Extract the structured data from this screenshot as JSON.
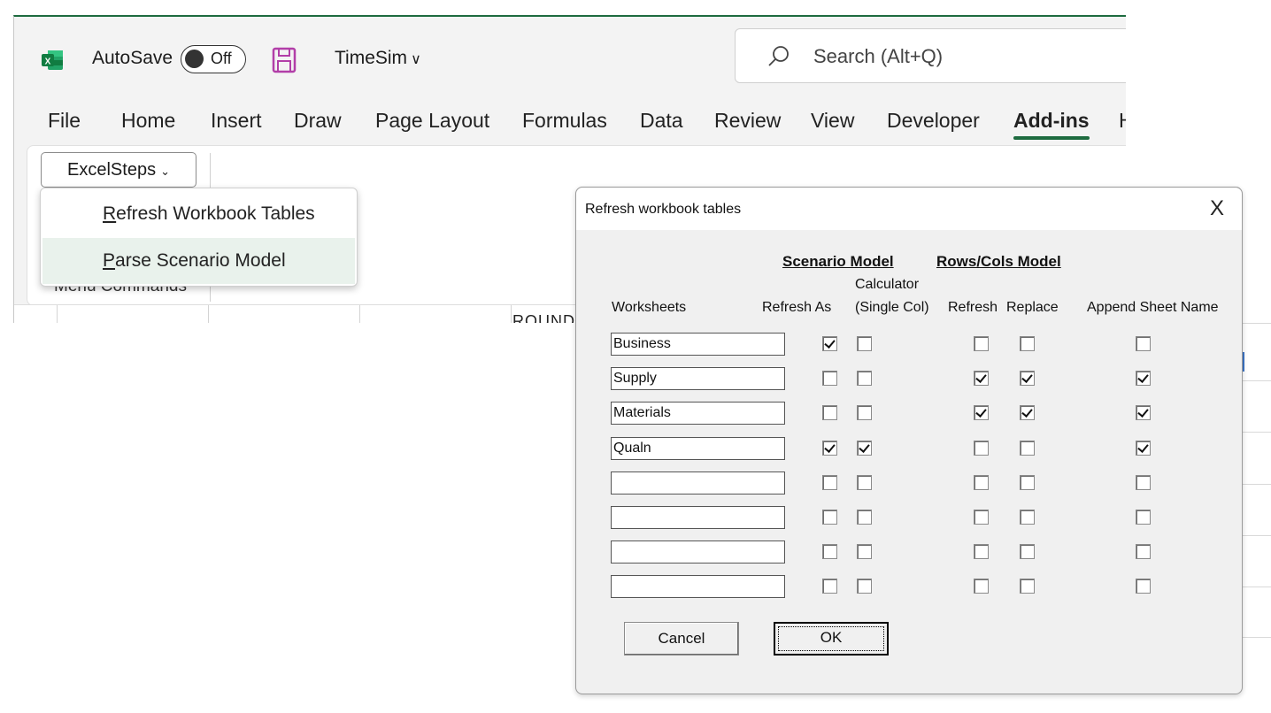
{
  "excel": {
    "autosave_label": "AutoSave",
    "autosave_state": "Off",
    "filename": "TimeSim",
    "filename_chevron": "∨",
    "search_placeholder": "Search (Alt+Q)",
    "icons": {
      "app": "excel-icon",
      "save": "save-icon",
      "search": "search-icon"
    },
    "accent_color": "#1d6b3f",
    "menu_tabs": [
      "File",
      "Home",
      "Insert",
      "Draw",
      "Page Layout",
      "Formulas",
      "Data",
      "Review",
      "View",
      "Developer",
      "Add-ins",
      "H"
    ],
    "active_tab": "Add-ins",
    "ribbon": {
      "group_button": "ExcelSteps",
      "group_button_chevron": "⌄",
      "group_label": "Menu Commands"
    },
    "sheet_fragment": "ROUND("
  },
  "dropdown": {
    "items": [
      {
        "accel": "R",
        "rest": "efresh Workbook Tables"
      },
      {
        "accel": "P",
        "rest": "arse Scenario Model"
      }
    ],
    "highlighted_index": 1
  },
  "dialog": {
    "title": "Refresh workbook tables",
    "close": "X",
    "group_headers": {
      "scenario": "Scenario Model",
      "rowscols": "Rows/Cols Model"
    },
    "column_headers": {
      "worksheets": "Worksheets",
      "refresh_as": "Refresh As",
      "calculator_line1": "Calculator",
      "calculator_line2": "(Single Col)",
      "refresh": "Refresh",
      "replace": "Replace",
      "append": "Append Sheet Name"
    },
    "rows": [
      {
        "name": "Business",
        "refresh_as": true,
        "calculator": false,
        "refresh": false,
        "replace": false,
        "append": false
      },
      {
        "name": "Supply",
        "refresh_as": false,
        "calculator": false,
        "refresh": true,
        "replace": true,
        "append": true
      },
      {
        "name": "Materials",
        "refresh_as": false,
        "calculator": false,
        "refresh": true,
        "replace": true,
        "append": true
      },
      {
        "name": "Qualn",
        "refresh_as": true,
        "calculator": true,
        "refresh": false,
        "replace": false,
        "append": true
      },
      {
        "name": "",
        "refresh_as": false,
        "calculator": false,
        "refresh": false,
        "replace": false,
        "append": false
      },
      {
        "name": "",
        "refresh_as": false,
        "calculator": false,
        "refresh": false,
        "replace": false,
        "append": false
      },
      {
        "name": "",
        "refresh_as": false,
        "calculator": false,
        "refresh": false,
        "replace": false,
        "append": false
      },
      {
        "name": "",
        "refresh_as": false,
        "calculator": false,
        "refresh": false,
        "replace": false,
        "append": false
      }
    ],
    "buttons": {
      "cancel": "Cancel",
      "ok": "OK"
    }
  }
}
